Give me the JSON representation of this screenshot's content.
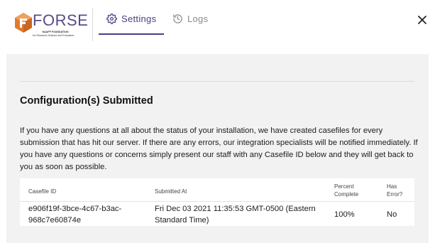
{
  "brand": {
    "name_part1": "FO",
    "name_part2": "RSE",
    "sub_line1": "NAAFP FOUNDATION",
    "sub_line2": "for Research Science and Education"
  },
  "tabs": [
    {
      "label": "Settings",
      "icon": "gear-icon",
      "active": true
    },
    {
      "label": "Logs",
      "icon": "history-icon",
      "active": false
    }
  ],
  "colors": {
    "accent": "#4e3c85",
    "inactive_tab": "#8a8a8a",
    "panel_bg": "#f2f2f2"
  },
  "main": {
    "title": "Configuration(s) Submitted",
    "description": "If you have any questions at all about the status of your installation, we have created casefiles for every submission that has hit our server. If there are any errors, our integration specialists will be notified immediately. If you have any questions or concerns simply present our staff with any Casefile ID below and they will get back to you as soon as possible."
  },
  "table": {
    "headers": {
      "casefile_id": "Casefile ID",
      "submitted_at": "Submitted At",
      "percent_complete": "Percent Complete",
      "has_error": "Has Error?"
    },
    "rows": [
      {
        "casefile_id": "e906f19f-3bce-4c67-b3ac-968c7e60874e",
        "submitted_at": "Fri Dec 03 2021 11:35:53 GMT-0500 (Eastern Standard Time)",
        "percent_complete": "100%",
        "has_error": "No"
      }
    ]
  }
}
